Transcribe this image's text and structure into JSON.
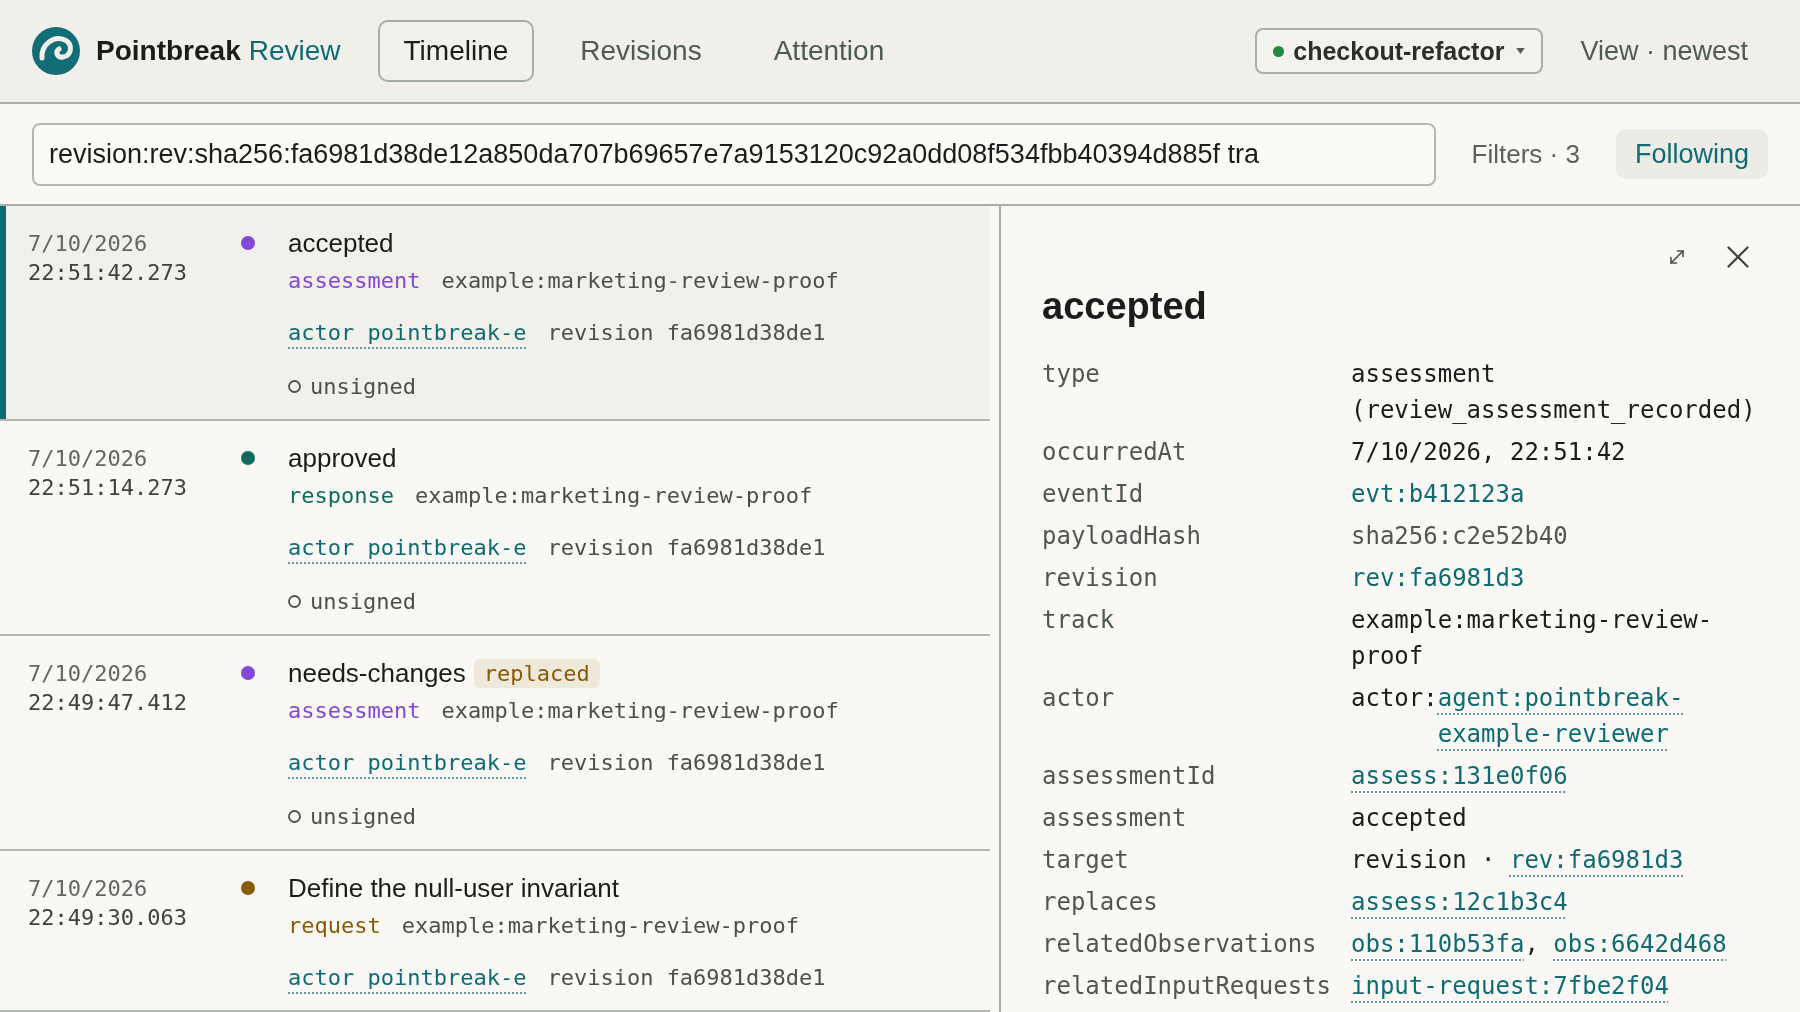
{
  "header": {
    "brand": "Pointbreak",
    "product": "Review",
    "tabs": [
      {
        "label": "Timeline",
        "selected": true
      },
      {
        "label": "Revisions",
        "selected": false
      },
      {
        "label": "Attention",
        "selected": false
      }
    ],
    "branch": "checkout-refactor",
    "view": "View · newest"
  },
  "search": {
    "value": "revision:rev:sha256:fa6981d38de12a850da707b69657e7a9153120c92a0dd08f534fbb40394d885f tra",
    "filters": "Filters · 3",
    "following": {
      "label": "Following",
      "on": true
    }
  },
  "events": [
    {
      "date": "7/10/2026",
      "time": "22:51:42.273",
      "color": "#8547d8",
      "title": "accepted",
      "type": "assessment",
      "track": "example:marketing-review-proof",
      "actor": "actor pointbreak-e",
      "revision": "revision fa6981d38de1",
      "signature": "unsigned",
      "selected": true
    },
    {
      "date": "7/10/2026",
      "time": "22:51:14.273",
      "color": "#0f6b5f",
      "title": "approved",
      "type": "response",
      "track": "example:marketing-review-proof",
      "actor": "actor pointbreak-e",
      "revision": "revision fa6981d38de1",
      "signature": "unsigned",
      "selected": false
    },
    {
      "date": "7/10/2026",
      "time": "22:49:47.412",
      "color": "#8547d8",
      "title": "needs-changes",
      "badge": "replaced",
      "type": "assessment",
      "track": "example:marketing-review-proof",
      "actor": "actor pointbreak-e",
      "revision": "revision fa6981d38de1",
      "signature": "unsigned",
      "selected": false
    },
    {
      "date": "7/10/2026",
      "time": "22:49:30.063",
      "color": "#8a5a00",
      "title": "Define the null-user invariant",
      "type": "request",
      "track": "example:marketing-review-proof",
      "actor": "actor pointbreak-e",
      "revision": "revision fa6981d38de1",
      "selected": false
    }
  ],
  "detail": {
    "title": "accepted",
    "fields": [
      {
        "label": "type",
        "parts": [
          {
            "kind": "plain",
            "text": "assessment (review_assessment_recorded)"
          }
        ]
      },
      {
        "label": "occurredAt",
        "parts": [
          {
            "kind": "plain",
            "text": "7/10/2026, 22:51:42"
          }
        ]
      },
      {
        "label": "eventId",
        "parts": [
          {
            "kind": "id",
            "text": "evt:b412123a"
          }
        ]
      },
      {
        "label": "payloadHash",
        "parts": [
          {
            "kind": "muted",
            "text": "sha256:c2e52b40"
          }
        ]
      },
      {
        "label": "revision",
        "parts": [
          {
            "kind": "id",
            "text": "rev:fa6981d3"
          }
        ]
      },
      {
        "label": "track",
        "parts": [
          {
            "kind": "plain",
            "text": "example:marketing-review-proof"
          }
        ]
      },
      {
        "label": "actor",
        "parts": [
          {
            "kind": "plain",
            "text": "actor:"
          },
          {
            "kind": "link",
            "text": "agent:pointbreak-example-reviewer"
          }
        ]
      },
      {
        "label": "assessmentId",
        "parts": [
          {
            "kind": "link",
            "text": "assess:131e0f06"
          }
        ]
      },
      {
        "label": "assessment",
        "parts": [
          {
            "kind": "plain",
            "text": "accepted"
          }
        ]
      },
      {
        "label": "target",
        "parts": [
          {
            "kind": "plain",
            "text": "revision · "
          },
          {
            "kind": "link",
            "text": "rev:fa6981d3"
          }
        ]
      },
      {
        "label": "replaces",
        "parts": [
          {
            "kind": "link",
            "text": "assess:12c1b3c4"
          }
        ]
      },
      {
        "label": "relatedObservations",
        "parts": [
          {
            "kind": "link",
            "text": "obs:110b53fa"
          },
          {
            "kind": "plain",
            "text": ", "
          },
          {
            "kind": "link",
            "text": "obs:6642d468"
          }
        ]
      },
      {
        "label": "relatedInputRequests",
        "parts": [
          {
            "kind": "link",
            "text": "input-request:7fbe2f04"
          }
        ]
      }
    ]
  }
}
